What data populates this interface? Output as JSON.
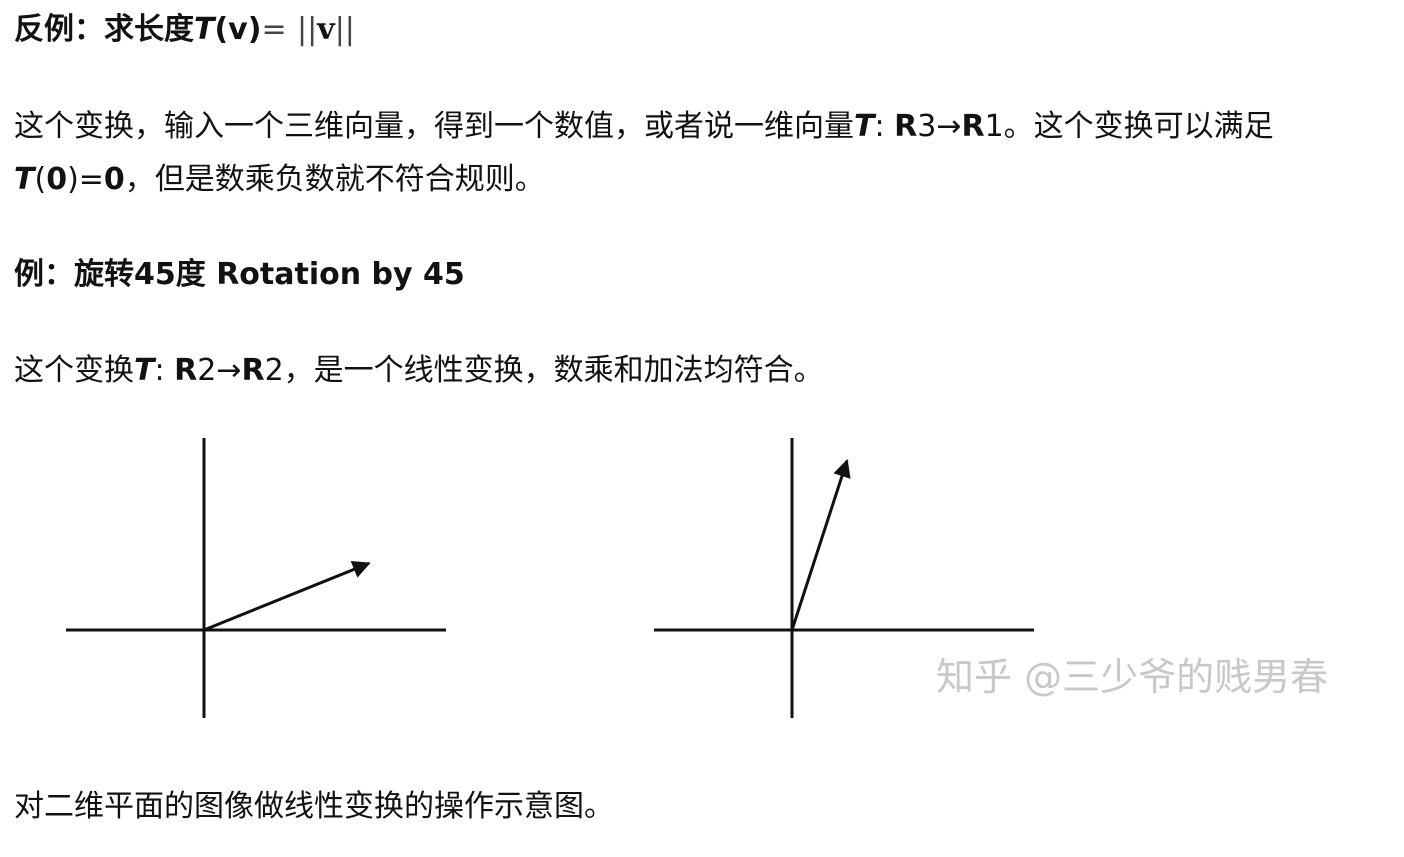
{
  "heading1": {
    "label": "反例：求长度",
    "var_T": "T",
    "arg": "(v)",
    "eq": "=",
    "norm_open": "||",
    "norm_var": "v",
    "norm_close": "||"
  },
  "para1": {
    "line1_text": "这个变换，输入一个三维向量，得到一个数值，或者说一维向量",
    "var_T": "T",
    "colon": ":",
    "R_from": "R",
    "dim_from": "3",
    "arrow": "→",
    "R_to": "R",
    "dim_to": "1",
    "line1_tail": "。这个变换可以满足",
    "line2_T": "T",
    "line2_paren_open": "(",
    "line2_zero": "0",
    "line2_paren_close": ")",
    "line2_eq": "=",
    "line2_zero2": "0",
    "line2_tail": "，但是数乘负数就不符合规则。"
  },
  "heading2": {
    "text": "例：旋转45度 Rotation by 45"
  },
  "para2": {
    "prefix": "这个变换",
    "var_T": "T",
    "colon": ":",
    "R_from": "R",
    "dim_from": "2",
    "arrow": "→",
    "R_to": "R",
    "dim_to": "2",
    "tail": "，是一个线性变换，数乘和加法均符合。"
  },
  "figure": {
    "left_vector": {
      "angle_deg": 22
    },
    "right_vector": {
      "angle_deg": 72
    },
    "watermark": "知乎 @三少爷的贱男春",
    "colors": {
      "axis": "#111111",
      "watermark": "#c8c8c8"
    }
  },
  "caption": {
    "text": "对二维平面的图像做线性变换的操作示意图。"
  }
}
